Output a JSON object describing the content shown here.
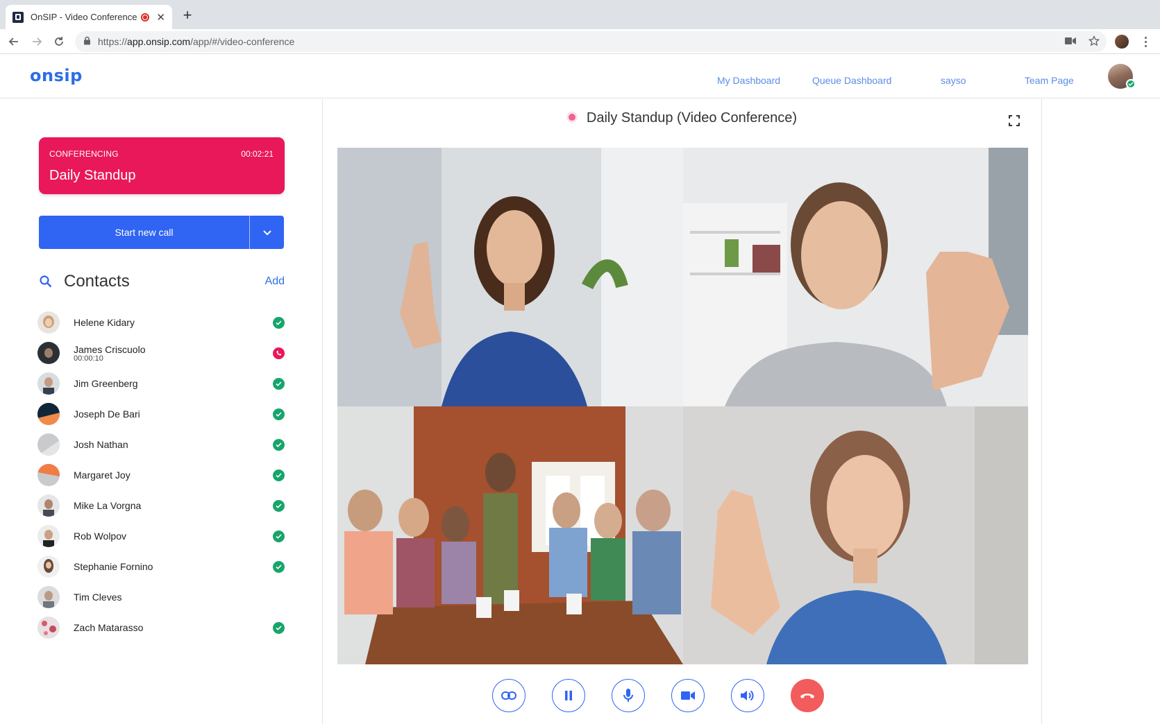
{
  "browser": {
    "tab_title": "OnSIP - Video Conference",
    "tab_close_icon": "close-icon",
    "new_tab_label": "+",
    "url_scheme": "https://",
    "url_host": "app.onsip.com",
    "url_path": "/app/#/video-conference"
  },
  "header": {
    "logo": "onsip",
    "nav": [
      "My Dashboard",
      "Queue Dashboard",
      "sayso",
      "Team Page"
    ],
    "user_status": "available"
  },
  "conference": {
    "status_label": "CONFERENCING",
    "elapsed": "00:02:21",
    "name": "Daily Standup"
  },
  "start_call": {
    "label": "Start new call"
  },
  "contacts": {
    "title": "Contacts",
    "add_label": "Add",
    "items": [
      {
        "name": "Helene Kidary",
        "sub": "",
        "status": "available"
      },
      {
        "name": "James Criscuolo",
        "sub": "00:00:10",
        "status": "oncall"
      },
      {
        "name": "Jim Greenberg",
        "sub": "",
        "status": "available"
      },
      {
        "name": "Joseph De Bari",
        "sub": "",
        "status": "available"
      },
      {
        "name": "Josh Nathan",
        "sub": "",
        "status": "available"
      },
      {
        "name": "Margaret Joy",
        "sub": "",
        "status": "available"
      },
      {
        "name": "Mike La Vorgna",
        "sub": "",
        "status": "available"
      },
      {
        "name": "Rob Wolpov",
        "sub": "",
        "status": "available"
      },
      {
        "name": "Stephanie Fornino",
        "sub": "",
        "status": "available"
      },
      {
        "name": "Tim Cleves",
        "sub": "",
        "status": "none"
      },
      {
        "name": "Zach Matarasso",
        "sub": "",
        "status": "available"
      }
    ]
  },
  "call": {
    "title": "Daily Standup (Video Conference)"
  },
  "controls": [
    "link-icon",
    "pause-icon",
    "microphone-icon",
    "video-camera-icon",
    "speaker-icon",
    "hang-up-icon"
  ],
  "colors": {
    "brand_blue": "#3064f2",
    "conference_pink": "#e8185a",
    "available_green": "#17a56b",
    "hangup_red": "#f25c5c"
  }
}
